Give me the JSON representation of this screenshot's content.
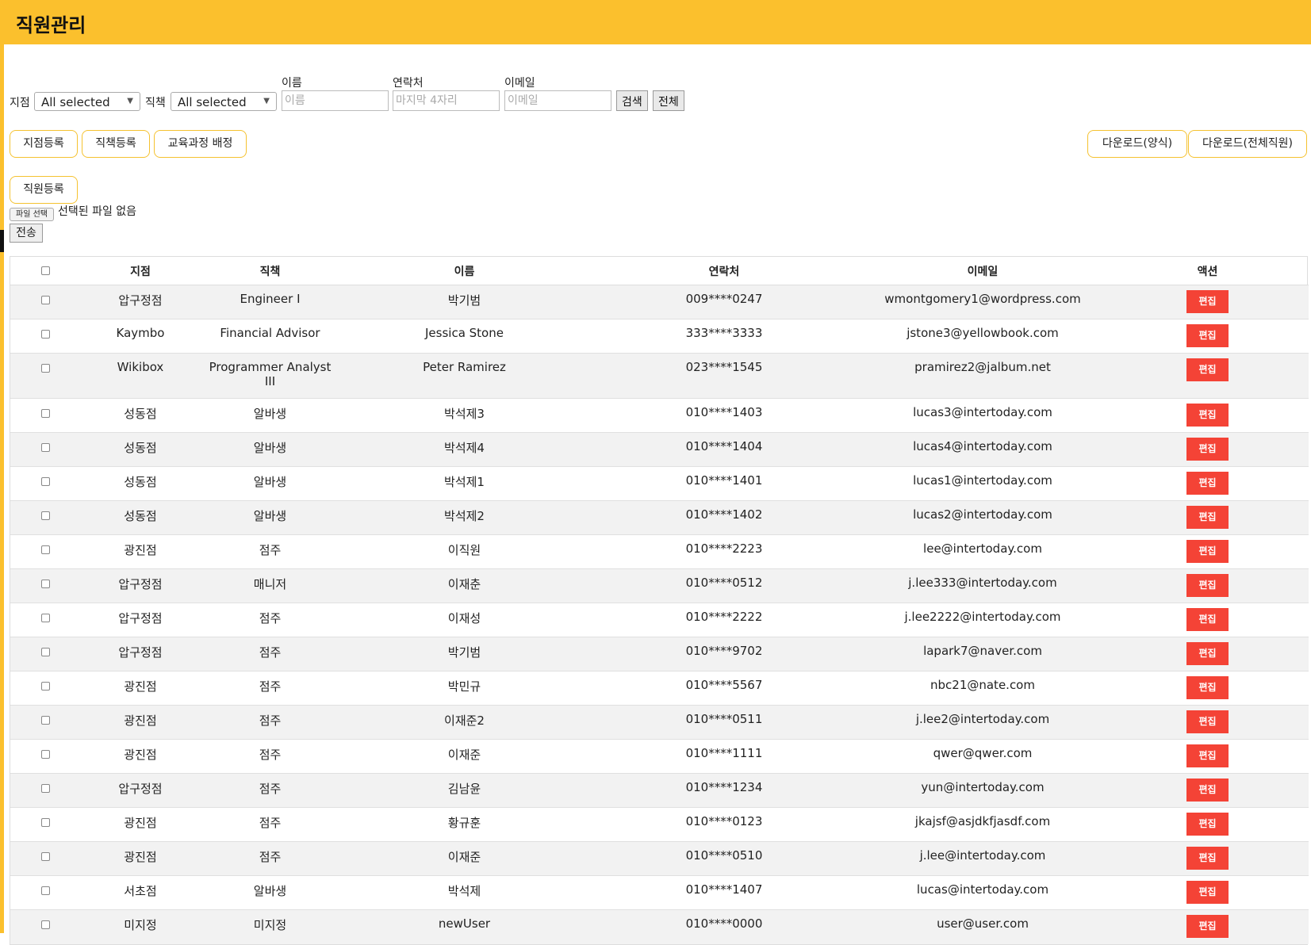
{
  "header": {
    "title": "직원관리"
  },
  "filters": {
    "branch_label": "지점",
    "branch_value": "All selected",
    "position_label": "직책",
    "position_value": "All selected",
    "name_label": "이름",
    "name_placeholder": "이름",
    "phone_label": "연락처",
    "phone_placeholder": "마지막 4자리",
    "email_label": "이메일",
    "email_placeholder": "이메일",
    "search_label": "검색",
    "all_label": "전체"
  },
  "actions": {
    "register_branch": "지점등록",
    "register_position": "직책등록",
    "assign_course": "교육과정 배정",
    "download_form": "다운로드(양식)",
    "download_all": "다운로드(전체직원)",
    "register_employee": "직원등록"
  },
  "upload": {
    "choose_file": "파일 선택",
    "no_file": "선택된 파일 없음",
    "send": "전송"
  },
  "table": {
    "headers": {
      "branch": "지점",
      "position": "직책",
      "name": "이름",
      "phone": "연락처",
      "email": "이메일",
      "action": "액션"
    },
    "edit_label": "편집",
    "rows": [
      {
        "branch": "압구정점",
        "position": "Engineer I",
        "name": "박기범",
        "phone": "009****0247",
        "email": "wmontgomery1@wordpress.com"
      },
      {
        "branch": "Kaymbo",
        "position": "Financial Advisor",
        "name": "Jessica Stone",
        "phone": "333****3333",
        "email": "jstone3@yellowbook.com"
      },
      {
        "branch": "Wikibox",
        "position": "Programmer Analyst III",
        "name": "Peter Ramirez",
        "phone": "023****1545",
        "email": "pramirez2@jalbum.net"
      },
      {
        "branch": "성동점",
        "position": "알바생",
        "name": "박석제3",
        "phone": "010****1403",
        "email": "lucas3@intertoday.com"
      },
      {
        "branch": "성동점",
        "position": "알바생",
        "name": "박석제4",
        "phone": "010****1404",
        "email": "lucas4@intertoday.com"
      },
      {
        "branch": "성동점",
        "position": "알바생",
        "name": "박석제1",
        "phone": "010****1401",
        "email": "lucas1@intertoday.com"
      },
      {
        "branch": "성동점",
        "position": "알바생",
        "name": "박석제2",
        "phone": "010****1402",
        "email": "lucas2@intertoday.com"
      },
      {
        "branch": "광진점",
        "position": "점주",
        "name": "이직원",
        "phone": "010****2223",
        "email": "lee@intertoday.com"
      },
      {
        "branch": "압구정점",
        "position": "매니저",
        "name": "이재춘",
        "phone": "010****0512",
        "email": "j.lee333@intertoday.com"
      },
      {
        "branch": "압구정점",
        "position": "점주",
        "name": "이재성",
        "phone": "010****2222",
        "email": "j.lee2222@intertoday.com"
      },
      {
        "branch": "압구정점",
        "position": "점주",
        "name": "박기범",
        "phone": "010****9702",
        "email": "lapark7@naver.com"
      },
      {
        "branch": "광진점",
        "position": "점주",
        "name": "박민규",
        "phone": "010****5567",
        "email": "nbc21@nate.com"
      },
      {
        "branch": "광진점",
        "position": "점주",
        "name": "이재준2",
        "phone": "010****0511",
        "email": "j.lee2@intertoday.com"
      },
      {
        "branch": "광진점",
        "position": "점주",
        "name": "이재준",
        "phone": "010****1111",
        "email": "qwer@qwer.com"
      },
      {
        "branch": "압구정점",
        "position": "점주",
        "name": "김남윤",
        "phone": "010****1234",
        "email": "yun@intertoday.com"
      },
      {
        "branch": "광진점",
        "position": "점주",
        "name": "황규훈",
        "phone": "010****0123",
        "email": "jkajsf@asjdkfjasdf.com"
      },
      {
        "branch": "광진점",
        "position": "점주",
        "name": "이재준",
        "phone": "010****0510",
        "email": "j.lee@intertoday.com"
      },
      {
        "branch": "서초점",
        "position": "알바생",
        "name": "박석제",
        "phone": "010****1407",
        "email": "lucas@intertoday.com"
      },
      {
        "branch": "미지정",
        "position": "미지정",
        "name": "newUser",
        "phone": "010****0000",
        "email": "user@user.com"
      }
    ]
  },
  "colors": {
    "brand": "#fbc02d",
    "edit": "#f44336"
  }
}
